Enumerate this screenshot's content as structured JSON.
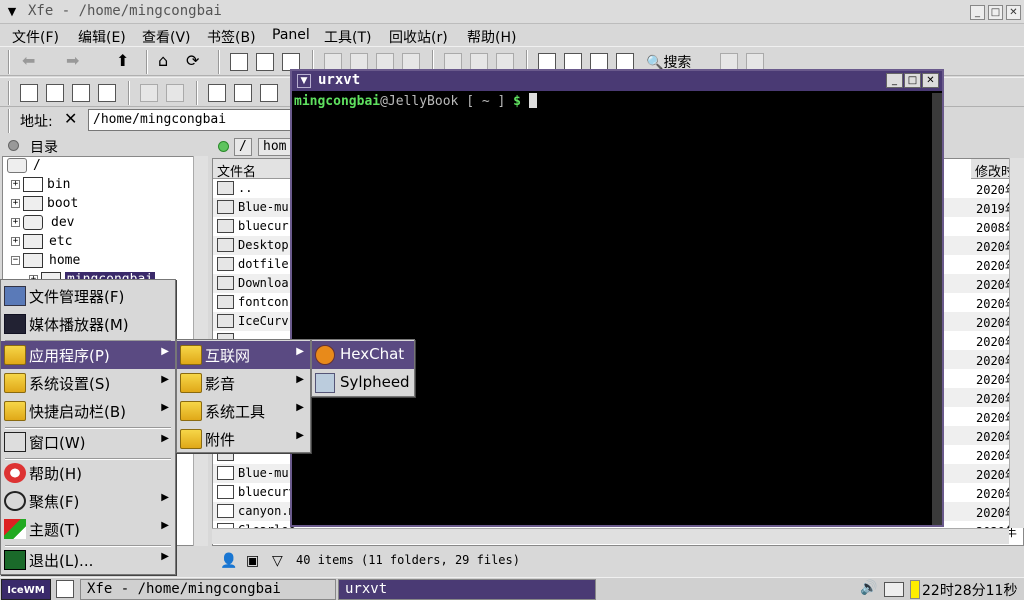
{
  "xfe": {
    "title": "Xfe - /home/mingcongbai",
    "menus": [
      "文件(F)",
      "编辑(E)",
      "查看(V)",
      "书签(B)",
      "Panel",
      "工具(T)",
      "回收站(r)",
      "帮助(H)"
    ],
    "search_label": "搜索",
    "address_label": "地址:",
    "address_value": "/home/mingcongbai",
    "tree_title": "目录",
    "tree": [
      {
        "name": "/",
        "indent": 0
      },
      {
        "name": "bin",
        "indent": 1
      },
      {
        "name": "boot",
        "indent": 1
      },
      {
        "name": "dev",
        "indent": 1
      },
      {
        "name": "etc",
        "indent": 1
      },
      {
        "name": "home",
        "indent": 1
      },
      {
        "name": "mingcongbai",
        "indent": 2
      }
    ],
    "path_buttons": [
      "/",
      "hom"
    ],
    "columns": {
      "name": "文件名",
      "modified": "修改时"
    },
    "files": [
      {
        "name": "..",
        "date": "2020年"
      },
      {
        "name": "Blue-mu",
        "date": "2019年"
      },
      {
        "name": "bluecur",
        "date": "2008年"
      },
      {
        "name": "Desktop",
        "date": "2020年"
      },
      {
        "name": "dotfile",
        "date": "2020年"
      },
      {
        "name": "Downloa",
        "date": "2020年"
      },
      {
        "name": "fontcon",
        "date": "2020年"
      },
      {
        "name": "IceCurv",
        "date": "2020年"
      },
      {
        "name": "",
        "date": "2020年"
      },
      {
        "name": "",
        "date": "2020年"
      },
      {
        "name": "",
        "date": "2020年"
      },
      {
        "name": "",
        "date": "2020年"
      },
      {
        "name": "",
        "date": "2020年"
      },
      {
        "name": "",
        "date": "2020年"
      },
      {
        "name": "",
        "date": "2020年"
      },
      {
        "name": "Blue-mu",
        "date": "2020年"
      },
      {
        "name": "bluecurv",
        "date": "2020年"
      },
      {
        "name": "canyon.m",
        "date": "2020年"
      },
      {
        "name": "Clearloo",
        "date": "2020年"
      }
    ],
    "status": "40 items (11 folders, 29 files)"
  },
  "urxvt": {
    "title": "urxvt",
    "prompt_user": "mingcongbai",
    "prompt_host": "@JellyBook",
    "prompt_path": " [ ~ ] ",
    "prompt_symbol": "$"
  },
  "start_menu": {
    "items": [
      "文件管理器(F)",
      "媒体播放器(M)",
      "应用程序(P)",
      "系统设置(S)",
      "快捷启动栏(B)",
      "窗口(W)",
      "帮助(H)",
      "聚焦(F)",
      "主题(T)",
      "退出(L)..."
    ],
    "apps_submenu": [
      "互联网",
      "影音",
      "系统工具",
      "附件"
    ],
    "internet_submenu": [
      "HexChat",
      "Sylpheed"
    ]
  },
  "taskbar": {
    "start": "IceWM",
    "tasks": [
      "Xfe - /home/mingcongbai",
      "urxvt"
    ],
    "clock": "22时28分11秒"
  }
}
